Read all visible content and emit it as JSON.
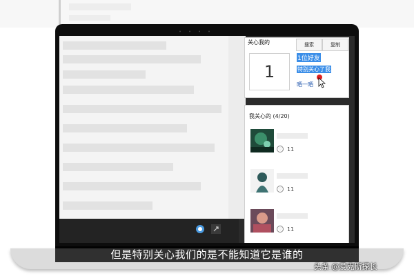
{
  "panel_top": {
    "title": "关心我的",
    "search_label": "搜索",
    "copy_label": "复制",
    "count": "1",
    "friend_line": "1位好友",
    "special_line": "特别关心了我",
    "share_link": "晒一晒"
  },
  "panel_bottom": {
    "header": "我关心的 (4/20)",
    "items": [
      {
        "avatar_icon": "avatar-image",
        "count": "11"
      },
      {
        "avatar_icon": "avatar-image",
        "count": "11"
      },
      {
        "avatar_icon": "avatar-image",
        "count": "11"
      }
    ]
  },
  "subtitle": "但是特别关心我们的是不能知道它是谁的",
  "watermark": "头条 @爱克斯探长",
  "colors": {
    "highlight": "#3b8ee8",
    "cursor_dot": "#e02020",
    "laptop_frame": "#0d0d0d"
  }
}
